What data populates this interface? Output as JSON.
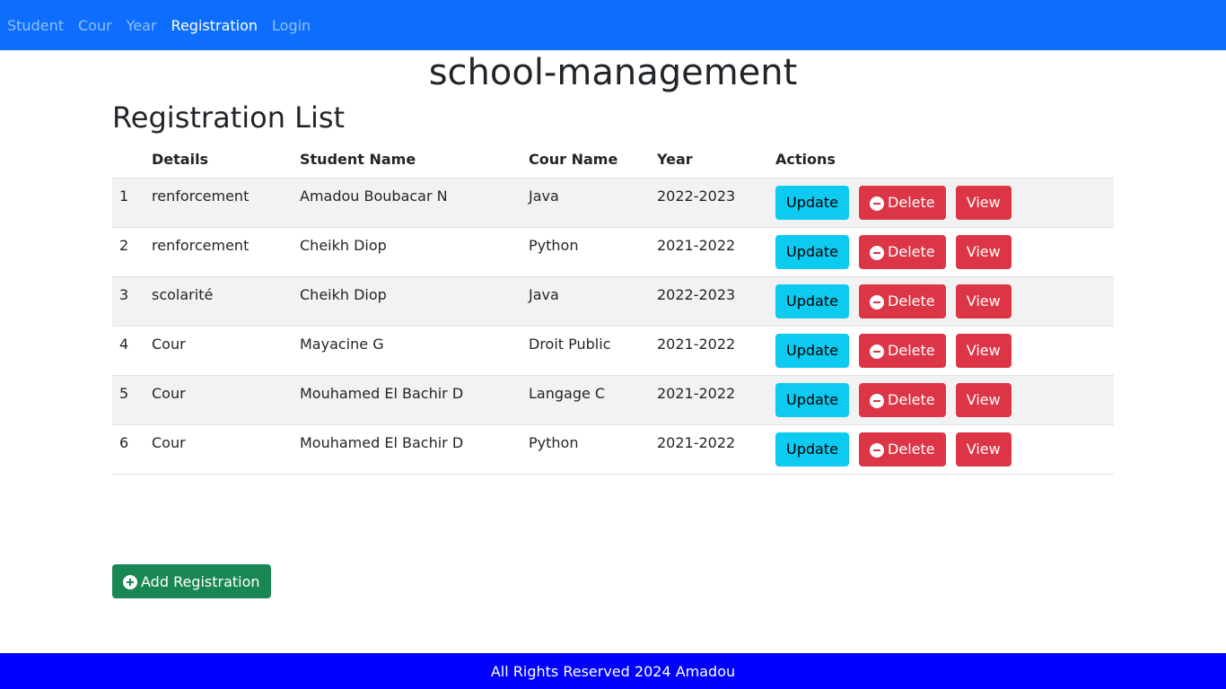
{
  "nav": {
    "items": [
      {
        "label": "Student",
        "active": false
      },
      {
        "label": "Cour",
        "active": false
      },
      {
        "label": "Year",
        "active": false
      },
      {
        "label": "Registration",
        "active": true
      },
      {
        "label": "Login",
        "active": false
      }
    ]
  },
  "app_title": "school-management",
  "section_title": "Registration List",
  "table": {
    "headers": [
      "",
      "Details",
      "Student Name",
      "Cour Name",
      "Year",
      "Actions"
    ],
    "rows": [
      {
        "num": "1",
        "details": "renforcement",
        "student": "Amadou Boubacar N",
        "cour": "Java",
        "year": "2022-2023"
      },
      {
        "num": "2",
        "details": "renforcement",
        "student": "Cheikh Diop",
        "cour": "Python",
        "year": "2021-2022"
      },
      {
        "num": "3",
        "details": "scolarité",
        "student": "Cheikh Diop",
        "cour": "Java",
        "year": "2022-2023"
      },
      {
        "num": "4",
        "details": "Cour",
        "student": "Mayacine G",
        "cour": "Droit Public",
        "year": "2021-2022"
      },
      {
        "num": "5",
        "details": "Cour",
        "student": "Mouhamed El Bachir D",
        "cour": "Langage C",
        "year": "2021-2022"
      },
      {
        "num": "6",
        "details": "Cour",
        "student": "Mouhamed El Bachir D",
        "cour": "Python",
        "year": "2021-2022"
      }
    ],
    "actions": {
      "update": "Update",
      "delete": "Delete",
      "view": "View"
    }
  },
  "add_button": "Add Registration",
  "footer": "All Rights Reserved 2024 Amadou",
  "colors": {
    "navbar": "#0d6efd",
    "footer": "#0000ff",
    "update": "#0dcaf0",
    "delete": "#dc3545",
    "add": "#198754"
  },
  "icons": {
    "delete": "minus-circle-icon",
    "add": "plus-circle-icon"
  }
}
